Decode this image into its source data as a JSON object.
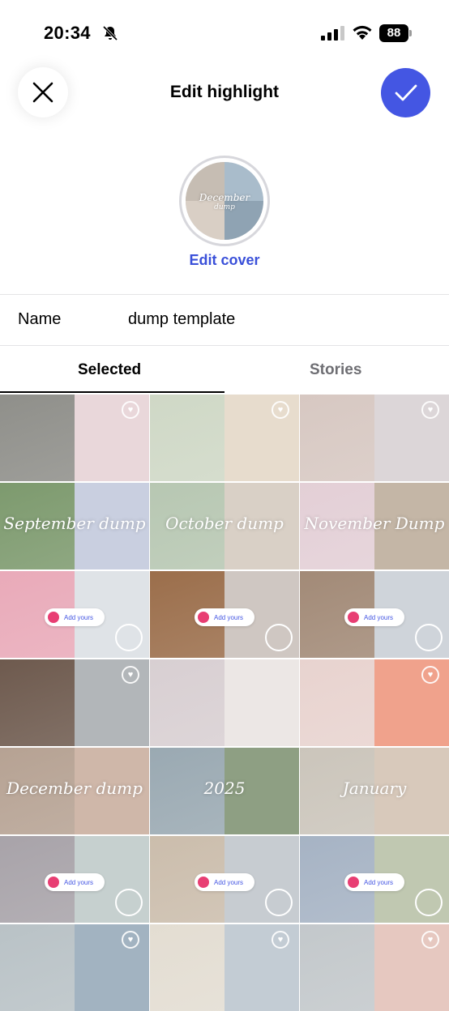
{
  "status_bar": {
    "time": "20:34",
    "battery": "88"
  },
  "header": {
    "title": "Edit highlight"
  },
  "cover": {
    "action_label": "Edit cover",
    "overlay_line1": "December",
    "overlay_line2": "dump"
  },
  "name_field": {
    "label": "Name",
    "value": "dump template"
  },
  "tabs": [
    {
      "label": "Selected"
    },
    {
      "label": "Stories"
    }
  ],
  "stories": [
    {
      "overlay": "",
      "heart": true,
      "add_yours": false,
      "select_circle": false
    },
    {
      "overlay": "",
      "heart": true,
      "add_yours": false,
      "select_circle": false
    },
    {
      "overlay": "",
      "heart": true,
      "add_yours": false,
      "select_circle": false
    },
    {
      "overlay": "September dump",
      "heart": false,
      "add_yours": false,
      "select_circle": false
    },
    {
      "overlay": "October dump",
      "heart": false,
      "add_yours": false,
      "select_circle": false
    },
    {
      "overlay": "November Dump",
      "heart": false,
      "add_yours": false,
      "select_circle": false
    },
    {
      "overlay": "",
      "heart": false,
      "add_yours": true,
      "select_circle": true
    },
    {
      "overlay": "",
      "heart": false,
      "add_yours": true,
      "select_circle": true
    },
    {
      "overlay": "",
      "heart": false,
      "add_yours": true,
      "select_circle": true
    },
    {
      "overlay": "",
      "heart": true,
      "add_yours": false,
      "select_circle": false
    },
    {
      "overlay": "",
      "heart": false,
      "add_yours": false,
      "select_circle": false
    },
    {
      "overlay": "",
      "heart": true,
      "add_yours": false,
      "select_circle": false
    },
    {
      "overlay": "December dump",
      "heart": false,
      "add_yours": false,
      "select_circle": false
    },
    {
      "overlay": "2025",
      "heart": false,
      "add_yours": false,
      "select_circle": false
    },
    {
      "overlay": "January",
      "heart": false,
      "add_yours": false,
      "select_circle": false
    },
    {
      "overlay": "",
      "heart": false,
      "add_yours": true,
      "select_circle": true
    },
    {
      "overlay": "",
      "heart": false,
      "add_yours": true,
      "select_circle": true
    },
    {
      "overlay": "",
      "heart": false,
      "add_yours": true,
      "select_circle": true
    },
    {
      "overlay": "",
      "heart": true,
      "add_yours": false,
      "select_circle": false
    },
    {
      "overlay": "",
      "heart": true,
      "add_yours": false,
      "select_circle": false
    },
    {
      "overlay": "",
      "heart": true,
      "add_yours": false,
      "select_circle": false
    }
  ],
  "add_yours_label": "Add yours",
  "colors": {
    "accent": "#4456e3",
    "link": "#3a50d9",
    "divider": "#e4e4e6",
    "inactive_tab": "#6e6e73"
  }
}
